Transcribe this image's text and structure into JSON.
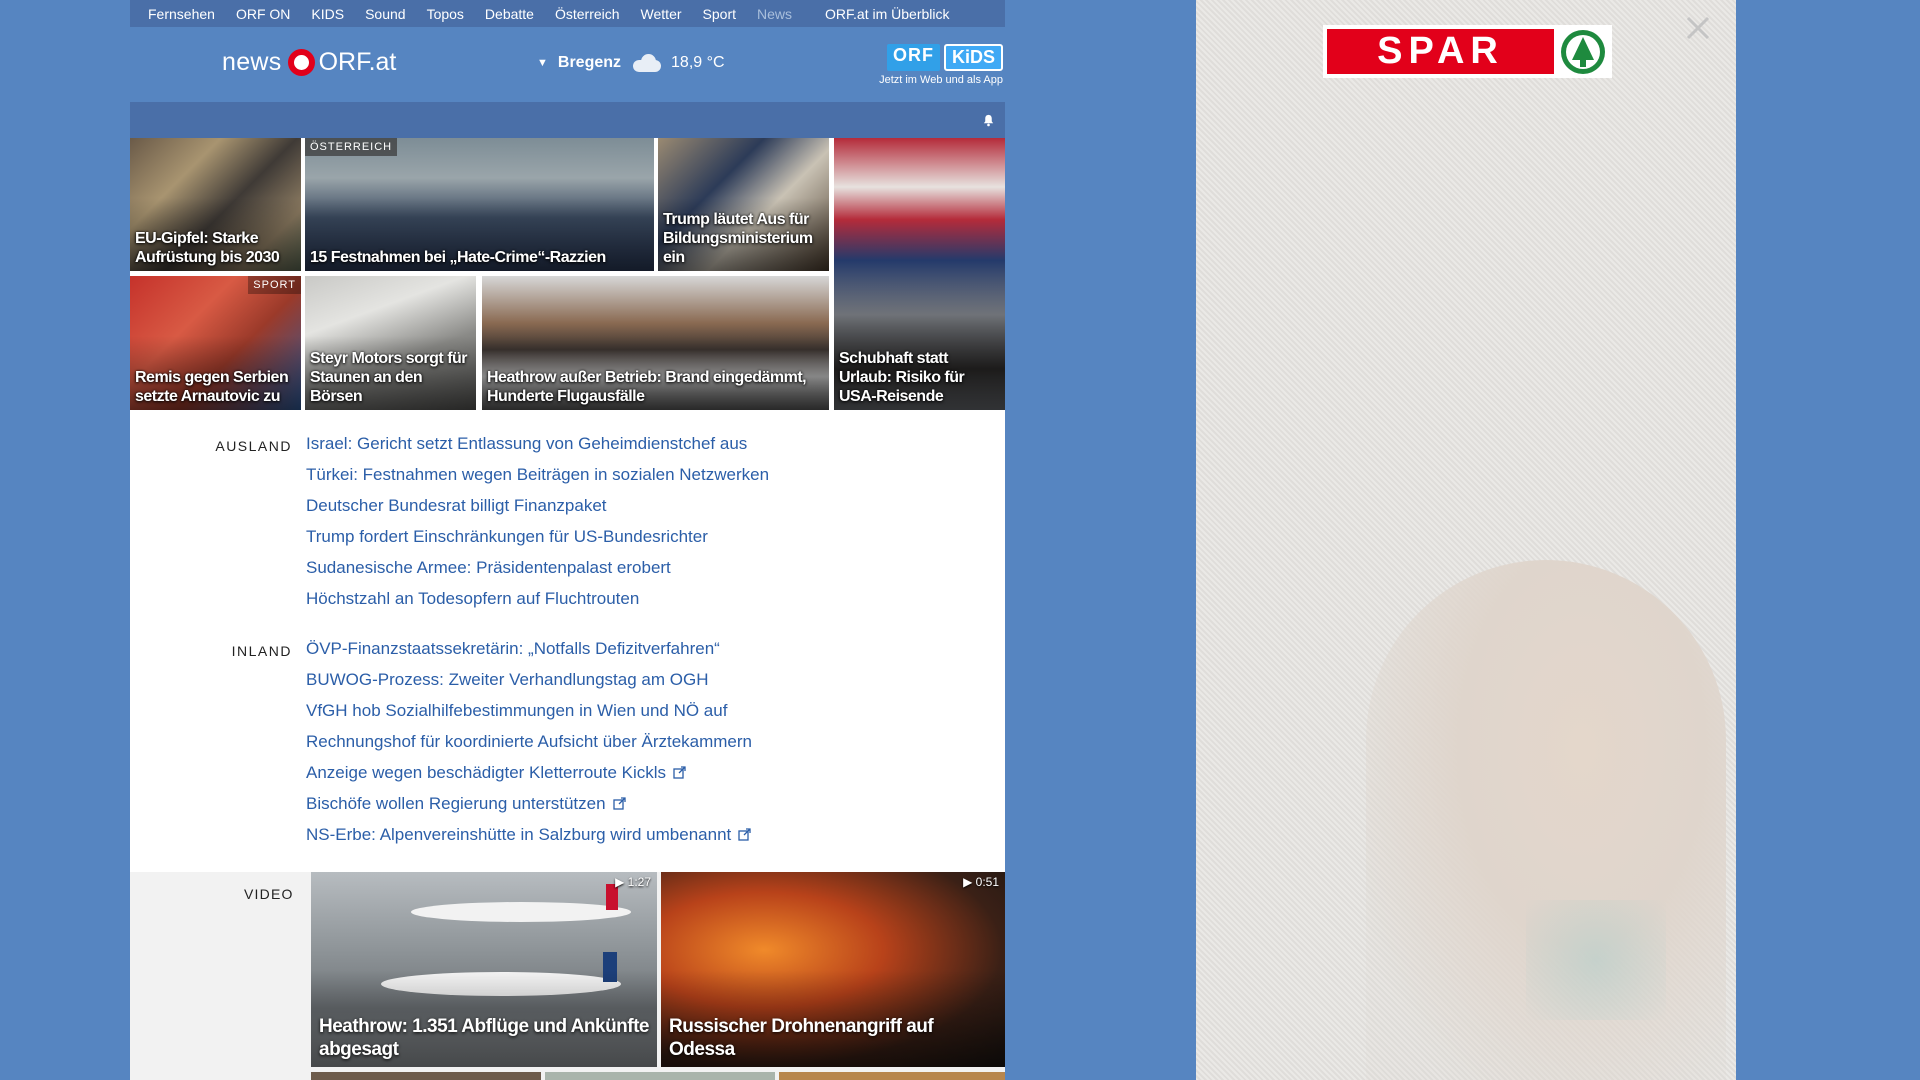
{
  "nav": {
    "items": [
      "Fernsehen",
      "ORF ON",
      "KIDS",
      "Sound",
      "Topos",
      "Debatte",
      "Österreich",
      "Wetter",
      "Sport",
      "News"
    ],
    "overview": "ORF.at im Überblick"
  },
  "header": {
    "logo_news": "news",
    "logo_orf": "ORF.at",
    "weather": {
      "city": "Bregenz",
      "temp": "18,9 °C",
      "icon": "cloud-icon"
    },
    "kids": {
      "badge_orf": "ORF",
      "badge_kids": "KiDS",
      "subtitle": "Jetzt im Web und als App"
    }
  },
  "tiles": [
    {
      "title": "EU-Gipfel: Starke Aufrüstung bis 2030",
      "tag": ""
    },
    {
      "title": "15 Festnahmen bei „Hate-Crime“-Razzien",
      "tag": "ÖSTERREICH"
    },
    {
      "title": "Trump läutet Aus für Bildungsministerium ein",
      "tag": ""
    },
    {
      "title": "",
      "tag": ""
    },
    {
      "title": "Remis gegen Serbien setzte Arnautovic zu",
      "tag": "SPORT"
    },
    {
      "title": "Steyr Motors sorgt für Staunen an den Börsen",
      "tag": ""
    },
    {
      "title": "Heathrow außer Betrieb: Brand eingedämmt, Hunderte Flugausfälle",
      "tag": ""
    },
    {
      "title": "Schubhaft statt Urlaub: Risiko für USA-Reisende",
      "tag": ""
    }
  ],
  "sections": {
    "ausland": {
      "label": "AUSLAND",
      "items": [
        "Israel: Gericht setzt Entlassung von Geheimdienstchef aus",
        "Türkei: Festnahmen wegen Beiträgen in sozialen Netzwerken",
        "Deutscher Bundesrat billigt Finanzpaket",
        "Trump fordert Einschränkungen für US-Bundesrichter",
        "Sudanesische Armee: Präsidentenpalast erobert",
        "Höchstzahl an Todesopfern auf Fluchtrouten"
      ]
    },
    "inland": {
      "label": "INLAND",
      "items": [
        "ÖVP-Finanzstaatssekretärin: „Notfalls Defizitverfahren“",
        "BUWOG-Prozess: Zweiter Verhandlungstag am OGH",
        "VfGH hob Sozialhilfebestimmungen in Wien und NÖ auf",
        "Rechnungshof für koordinierte Aufsicht über Ärztekammern",
        "Anzeige wegen beschädigter Kletterroute Kickls",
        "Bischöfe wollen Regierung unterstützen",
        "NS-Erbe: Alpenvereinshütte in Salzburg wird umbenannt"
      ],
      "external": [
        false,
        false,
        false,
        false,
        true,
        true,
        true
      ]
    }
  },
  "video": {
    "label": "VIDEO",
    "items": [
      {
        "title": "Heathrow: 1.351 Abflüge und Ankünfte abgesagt",
        "duration": "1:27"
      },
      {
        "title": "Russischer Drohnenangriff auf Odessa",
        "duration": "0:51"
      }
    ]
  },
  "ad": {
    "brand": "SPAR",
    "close": "close-icon"
  },
  "colors": {
    "page_bg": "#5685c1",
    "nav_bg": "#4a6fa8",
    "link": "#2b5ea8",
    "orf_red": "#e2001a",
    "spar_red": "#e2001a",
    "spar_green": "#1e8a3e"
  }
}
